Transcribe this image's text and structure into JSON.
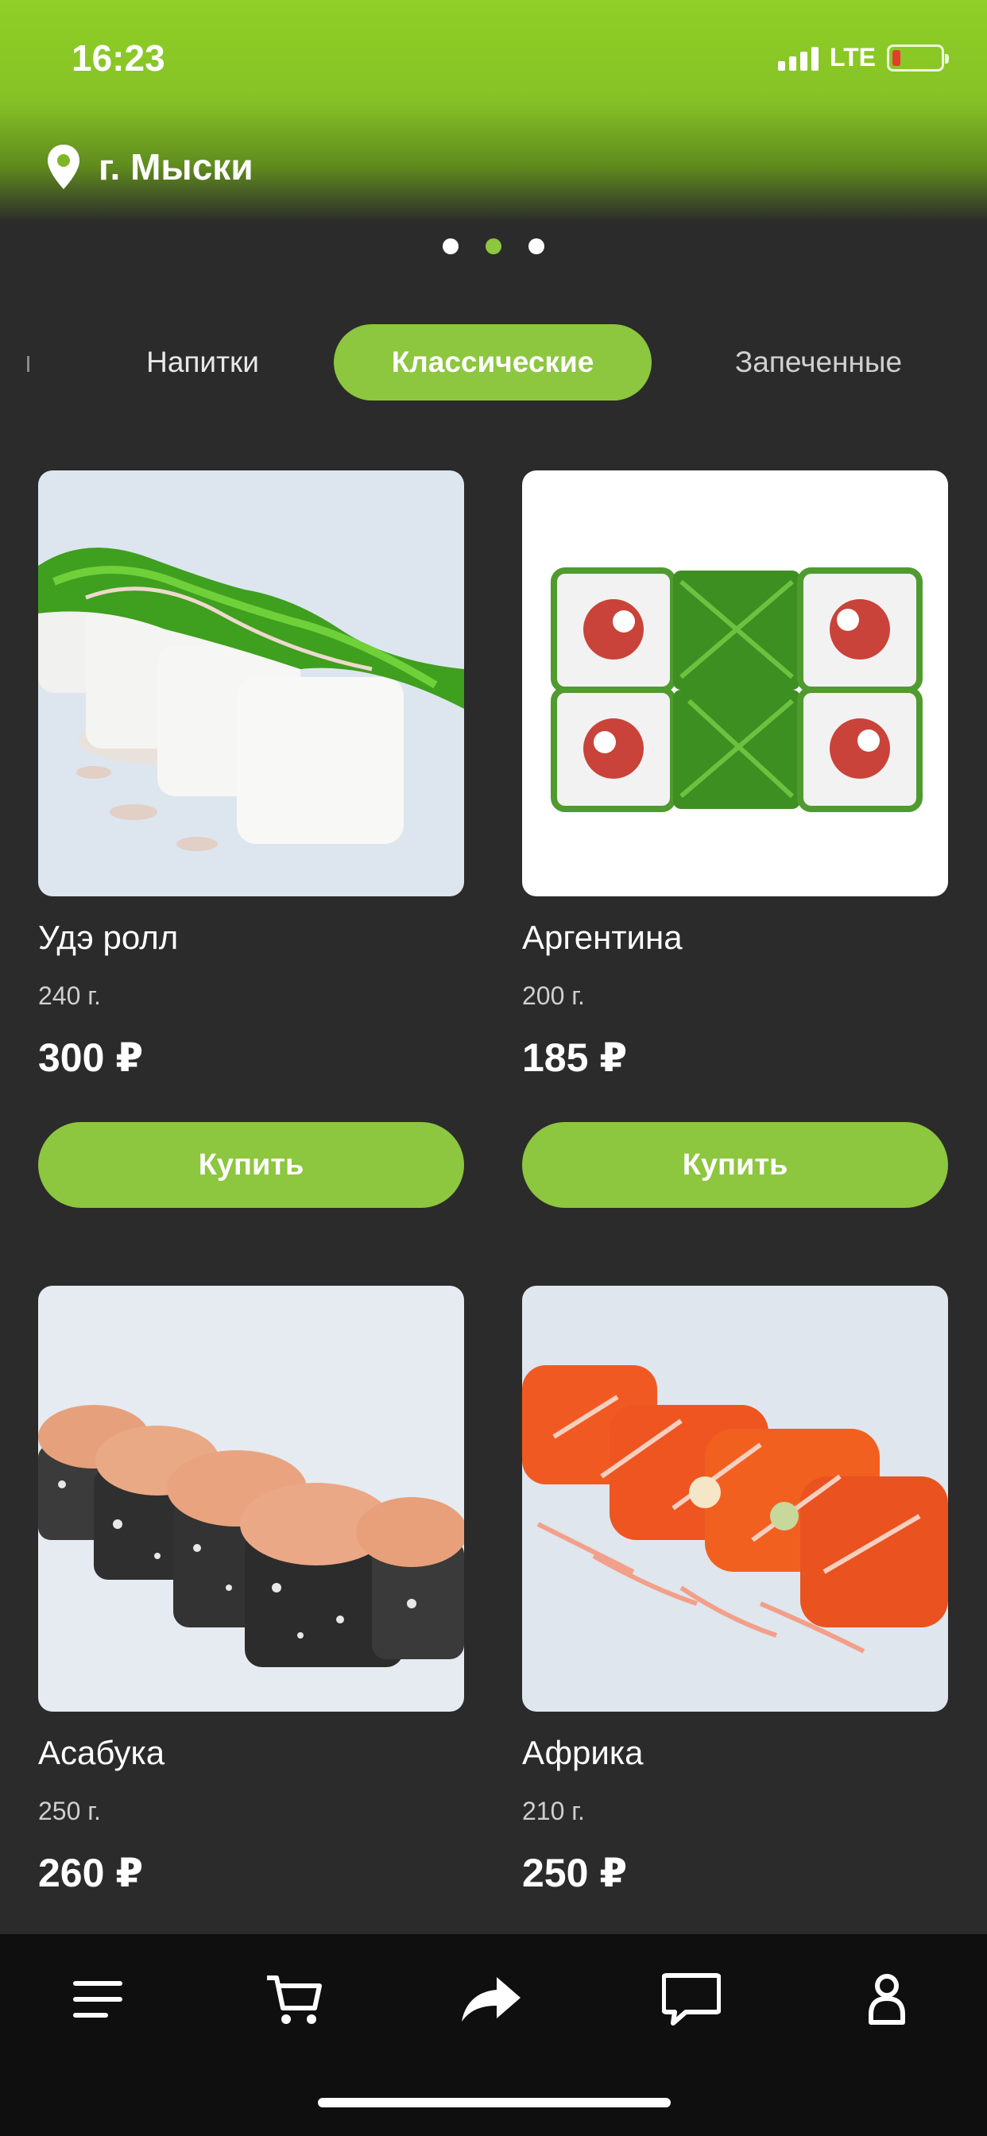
{
  "status_bar": {
    "time": "16:23",
    "network": "LTE"
  },
  "header": {
    "location": "г. Мыски"
  },
  "categories": {
    "items": [
      {
        "label": "Напитки"
      },
      {
        "label": "Классические"
      },
      {
        "label": "Запеченные"
      }
    ],
    "active": "Классические"
  },
  "carousel": {
    "page_count": 3,
    "active_index": 1
  },
  "products": [
    {
      "name": "Удэ ролл",
      "weight": "240 г.",
      "price": "300 ₽",
      "buy_label": "Купить"
    },
    {
      "name": "Аргентина",
      "weight": "200 г.",
      "price": "185 ₽",
      "buy_label": "Купить"
    },
    {
      "name": "Асабука",
      "weight": "250 г.",
      "price": "260 ₽"
    },
    {
      "name": "Африка",
      "weight": "210 г.",
      "price": "250 ₽"
    }
  ],
  "bottom_nav": {
    "items": [
      {
        "icon": "menu-icon"
      },
      {
        "icon": "cart-icon"
      },
      {
        "icon": "share-icon"
      },
      {
        "icon": "chat-icon"
      },
      {
        "icon": "profile-icon"
      }
    ]
  },
  "colors": {
    "accent": "#8dc63f",
    "background": "#2b2b2b",
    "nav_background": "#0f0f0f"
  }
}
